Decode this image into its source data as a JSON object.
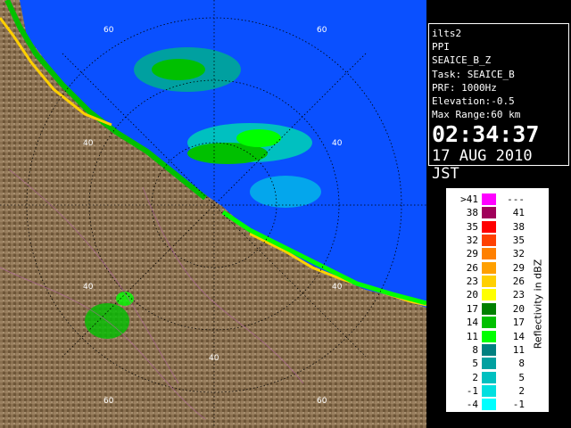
{
  "info": {
    "station": "ilts2",
    "product": "PPI",
    "field": "SEAICE_B_Z",
    "task": "Task: SEAICE_B",
    "prf": "PRF: 1000Hz",
    "elevation": "Elevation:-0.5",
    "max_range": "Max Range:60 km",
    "time": "02:34:37",
    "date": "17 AUG 2010 JST"
  },
  "range_ring_labels": {
    "r60_top": "60",
    "r60_topright": "60",
    "r40_left": "40",
    "r40_right": "40",
    "r40_lower_left": "40",
    "r40_lower_right": "40",
    "r40_bottom": "40",
    "r60_bottom": "60",
    "r60_bottom2": "60"
  },
  "legend": {
    "title": "Reflectivity in dBZ",
    "rows": [
      {
        "left": ">41",
        "right": "---",
        "color": "#ff00ff"
      },
      {
        "left": "38",
        "right": "41",
        "color": "#a0005a"
      },
      {
        "left": "35",
        "right": "38",
        "color": "#ff0000"
      },
      {
        "left": "32",
        "right": "35",
        "color": "#ff4000"
      },
      {
        "left": "29",
        "right": "32",
        "color": "#ff8000"
      },
      {
        "left": "26",
        "right": "29",
        "color": "#ffa000"
      },
      {
        "left": "23",
        "right": "26",
        "color": "#ffd000"
      },
      {
        "left": "20",
        "right": "23",
        "color": "#ffff00"
      },
      {
        "left": "17",
        "right": "20",
        "color": "#008000"
      },
      {
        "left": "14",
        "right": "17",
        "color": "#00c000"
      },
      {
        "left": "11",
        "right": "14",
        "color": "#00ff00"
      },
      {
        "left": "8",
        "right": "11",
        "color": "#008080"
      },
      {
        "left": "5",
        "right": "8",
        "color": "#00a0a0"
      },
      {
        "left": "2",
        "right": "5",
        "color": "#00c0c0"
      },
      {
        "left": "-1",
        "right": "2",
        "color": "#00e0e0"
      },
      {
        "left": "-4",
        "right": "-1",
        "color": "#00ffff"
      }
    ]
  },
  "colors": {
    "sea": "#0a50ff",
    "land": "#8a7050",
    "ring": "#000000"
  }
}
